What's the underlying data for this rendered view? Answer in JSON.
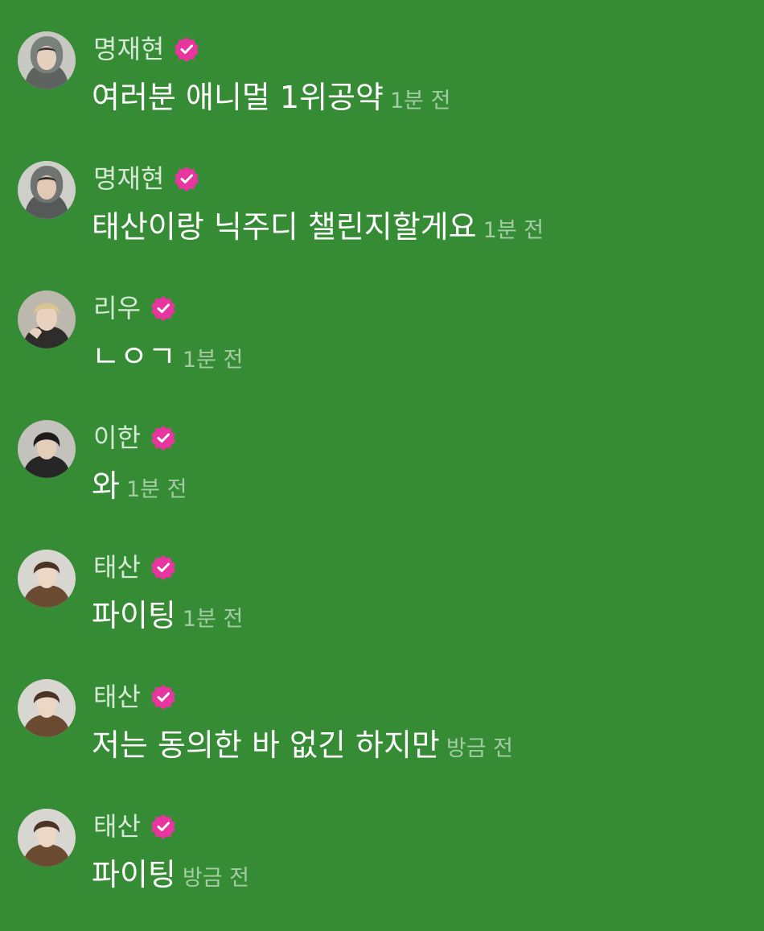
{
  "colors": {
    "background": "#358c35",
    "verified_badge": "#e9359f",
    "name_text": "#d6e8d6",
    "message_text": "#ffffff",
    "time_text": "#a9cba9"
  },
  "messages": [
    {
      "name": "명재현",
      "text": "여러분 애니멀 1위공약",
      "time": "1분 전",
      "avatar": "avatar-gray-hoodie",
      "verified_icon": "verified-badge-icon"
    },
    {
      "name": "명재현",
      "text": "태산이랑 닉주디 챌린지할게요",
      "time": "1분 전",
      "avatar": "avatar-gray-hoodie",
      "verified_icon": "verified-badge-icon"
    },
    {
      "name": "리우",
      "text": "ㄴㅇㄱ",
      "time": "1분 전",
      "avatar": "avatar-blond",
      "verified_icon": "verified-badge-icon"
    },
    {
      "name": "이한",
      "text": "와",
      "time": "1분 전",
      "avatar": "avatar-dark-hair",
      "verified_icon": "verified-badge-icon"
    },
    {
      "name": "태산",
      "text": "파이팅",
      "time": "1분 전",
      "avatar": "avatar-brown-jacket",
      "verified_icon": "verified-badge-icon"
    },
    {
      "name": "태산",
      "text": "저는 동의한 바 없긴 하지만",
      "time": "방금 전",
      "avatar": "avatar-brown-jacket",
      "verified_icon": "verified-badge-icon"
    },
    {
      "name": "태산",
      "text": "파이팅",
      "time": "방금 전",
      "avatar": "avatar-brown-jacket",
      "verified_icon": "verified-badge-icon"
    }
  ]
}
